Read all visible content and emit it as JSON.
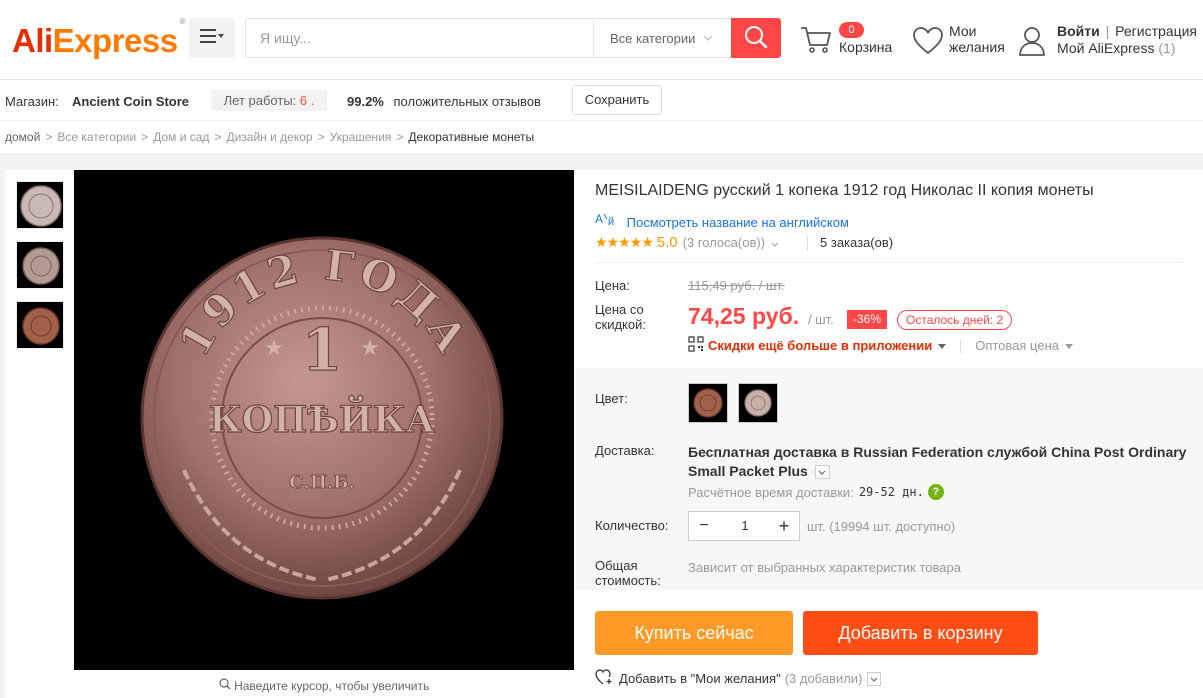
{
  "header": {
    "logo_main": "Ali",
    "logo_accent": "Express",
    "logo_mark": "®",
    "search_placeholder": "Я ищу...",
    "category_select": "Все категории",
    "cart_count": "0",
    "cart_label": "Корзина",
    "wishlist_label": "Мои желания",
    "login": "Войти",
    "separator": "|",
    "register": "Регистрация",
    "my_account": "Мой AliExpress",
    "my_account_count": "(1)"
  },
  "store": {
    "label": "Магазин:",
    "name": "Ancient Coin Store",
    "years_label": "Лет работы:",
    "years_value": "6 .",
    "feedback_pct": "99.2%",
    "feedback_label": "положительных отзывов",
    "save_label": "Сохранить"
  },
  "breadcrumb": {
    "items": [
      "домой",
      "Все категории",
      "Дом и сад",
      "Дизайн и декор",
      "Украшения"
    ],
    "current": "Декоративные монеты",
    "separator": ">"
  },
  "gallery": {
    "zoom_hint": "Наведите курсор, чтобы увеличить",
    "coin_top_text": "1912 ГОДА",
    "coin_value": "1",
    "coin_word": "КОПѢЙКА",
    "coin_mint": "С.П.Б."
  },
  "product": {
    "title": "MEISILAIDENG русский 1 копека 1912 год Николас II копия монеты",
    "translate_link": "Посмотреть название на английском",
    "rating_stars": "★★★★★",
    "rating_value": "5.0",
    "votes": "(3 голоса(ов))",
    "orders": "5 заказа(ов)",
    "price_label": "Цена:",
    "price_old": "115,49 руб. / шт.",
    "discount_price_label": "Цена со скидкой:",
    "price_new": "74,25 руб.",
    "per_unit": "/ шт.",
    "discount_pct": "-36%",
    "days_left": "Осталось дней: 2",
    "app_discount": "Скидки ещё больше в приложении",
    "wholesale": "Оптовая цена",
    "color_label": "Цвет:",
    "shipping_label": "Доставка:",
    "shipping_free": "Бесплатная доставка в",
    "shipping_country": "Russian Federation",
    "shipping_service": "службой China Post Ordinary Small Packet Plus",
    "delivery_time_label": "Расчётное время доставки:",
    "delivery_time_value": "29-52 дн.",
    "quantity_label": "Количество:",
    "quantity_value": "1",
    "stock_unit": "шт.",
    "stock_available": "(19994 шт. доступно)",
    "total_label": "Общая стоимость:",
    "total_value": "Зависит от выбранных характеристик товара",
    "buy_now": "Купить сейчас",
    "add_to_cart": "Добавить в корзину",
    "add_to_wishlist": "Добавить в \"Мои желания\"",
    "wishlist_count": "(3 добавили)"
  },
  "colors": {
    "brand_red": "#ff4747",
    "brand_orange": "#ff9a26",
    "cart_orange": "#ff4d13",
    "link_blue": "#1a73e8",
    "star": "#ff9a00",
    "coin": "#a0706a"
  },
  "icons": [
    "menu-icon",
    "search-icon",
    "cart-icon",
    "heart-icon",
    "user-icon",
    "translate-icon",
    "qr-code-icon",
    "question-icon",
    "magnifier-icon",
    "chevron-down-icon"
  ]
}
